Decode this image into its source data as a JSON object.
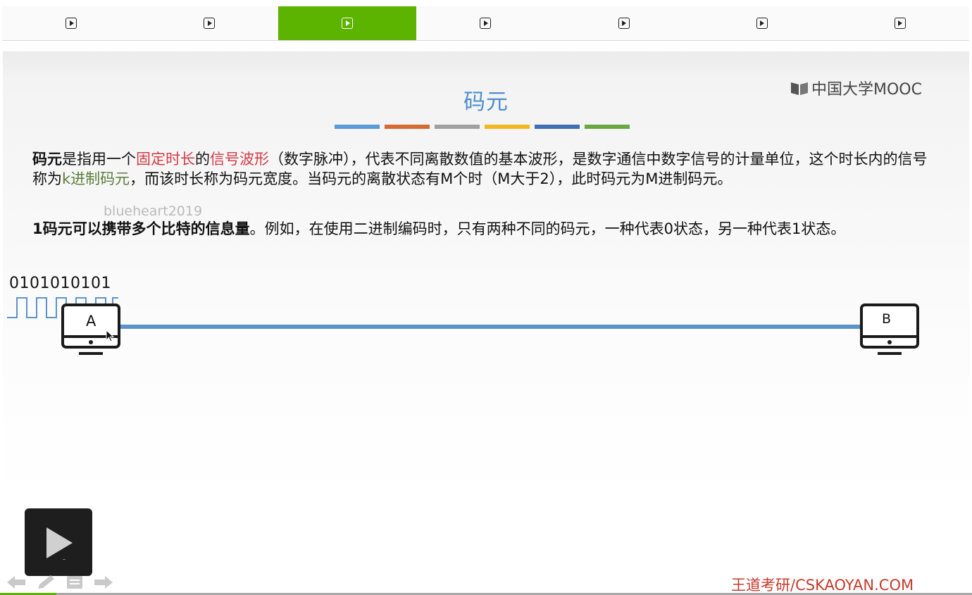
{
  "tabs": [
    {
      "icon": "play-square-icon",
      "active": false
    },
    {
      "icon": "play-square-icon",
      "active": false
    },
    {
      "icon": "play-square-icon",
      "active": true
    },
    {
      "icon": "play-square-icon",
      "active": false
    },
    {
      "icon": "play-square-icon",
      "active": false
    },
    {
      "icon": "play-square-icon",
      "active": false
    },
    {
      "icon": "play-square-icon",
      "active": false
    }
  ],
  "slide": {
    "title": "码元",
    "title_bar_colors": [
      "#5b9bd5",
      "#d36b32",
      "#a0a0a0",
      "#f2b821",
      "#3f6eb5",
      "#6aa844"
    ],
    "logo_text": "中国大学MOOC",
    "para1": {
      "t1": "码元",
      "t2": "是指用一个",
      "t3": "固定时长",
      "t4": "的",
      "t5": "信号波形",
      "t6": "（数字脉冲），代表不同离散数值的基本波形，是数字通信中数字信号的计量单位，这个时长内的信号称为",
      "t7": "k进制码元",
      "t8": "，而该时长称为码元宽度。当码元的离散状态有M个时（M大于2），此时码元为M进制码元。"
    },
    "para2": {
      "t1": "1码元可以携带多个比特的信息量",
      "t2": "。例如，在使用二进制编码时，只有两种不同的码元，一种代表0状态，另一种代表1状态。"
    },
    "watermark": "blueheart2019",
    "bit_string": "0101010101",
    "host_a_label": "A",
    "host_b_label": "B",
    "footer_brand": "王道考研/CSKAOYAN.COM",
    "colors": {
      "accent_blue": "#4f8ecb",
      "emphasis_red": "#d33a45",
      "emphasis_green": "#5a7d3a",
      "link_blue": "#5b94cb"
    }
  },
  "player": {
    "play_icon": "play-icon",
    "nav_icons": [
      "arrow-left-icon",
      "pen-icon",
      "notes-icon",
      "arrow-right-icon"
    ],
    "progress_fraction": 0.058,
    "active_tab_color": "#5cb300"
  }
}
